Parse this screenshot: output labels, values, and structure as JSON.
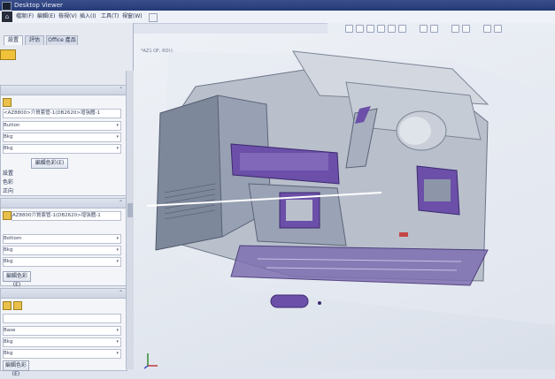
{
  "window": {
    "title": "Desktop Viewer"
  },
  "menu": [
    {
      "label": "檔案(F)"
    },
    {
      "label": "編輯(E)"
    },
    {
      "label": "檢視(V)"
    },
    {
      "label": "插入(I)"
    },
    {
      "label": "工具(T)"
    },
    {
      "label": "視窗(W)"
    }
  ],
  "tabs": [
    {
      "label": "設置"
    },
    {
      "label": "評估"
    },
    {
      "label": "Office 產品"
    }
  ],
  "sections": [
    {
      "fields": [
        {
          "value": "<AZ8800>介質套管-1(DB2620>增強體-1"
        },
        {
          "value": "Button"
        },
        {
          "value": "Bkg"
        },
        {
          "value": "Bkg"
        }
      ],
      "button": "編輯色彩(E)",
      "options": [
        "設置",
        "色彩",
        "正向"
      ]
    },
    {
      "fields": [
        {
          "value": "AZ8800介質套管-1(DB2620>增強體-1"
        },
        {
          "value": "Bottom"
        },
        {
          "value": "Bkg"
        },
        {
          "value": "Bkg"
        }
      ],
      "button": "編輯色彩(E)"
    },
    {
      "fields": [
        {
          "value": ""
        },
        {
          "value": "Base"
        },
        {
          "value": "Bkg"
        },
        {
          "value": "Bkg"
        }
      ],
      "button": "編輯色彩(E)"
    }
  ],
  "viewport": {
    "label": "*AZ1 OF, ROLL"
  },
  "colors": {
    "accent": "#5b3a9e",
    "model_gray": "#8d96a8",
    "model_light": "#c9ced8"
  }
}
